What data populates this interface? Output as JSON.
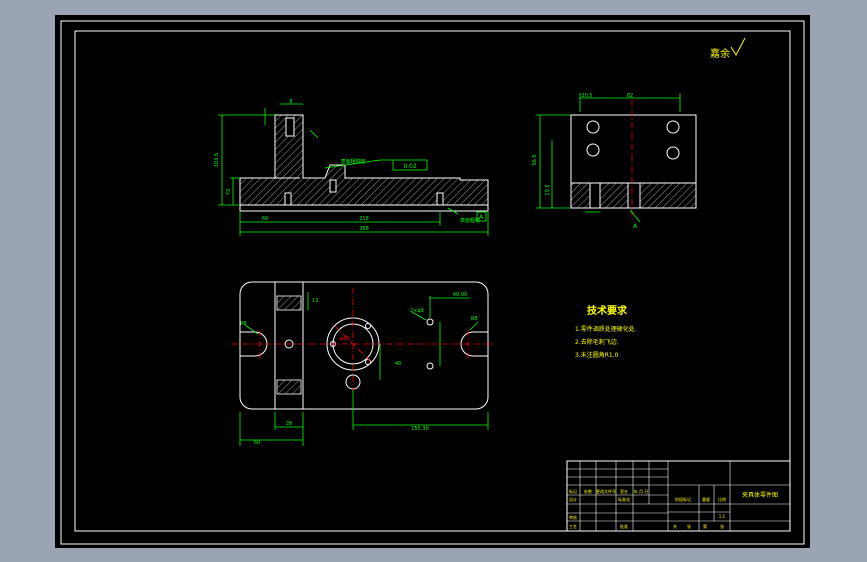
{
  "surface_note": "嘉余",
  "colors": {
    "background": "#000000",
    "outline": "#ffffff",
    "dimension": "#00ff00",
    "centerline": "#ff0000",
    "hatch": "#808080",
    "text_yellow": "#ffff00",
    "viewport_bg": "#9aa4b2"
  },
  "tech_requirements": {
    "title": "技术要求",
    "items": [
      "1.零件调质处理硬化处.",
      "2.去除毛刺飞边.",
      "3.未注圆角R1.0"
    ]
  },
  "title_block": {
    "drawing_name": "夹具体零件图",
    "scale": "1:1",
    "rows": {
      "mark_row": [
        "标记",
        "处数",
        "更改文件号",
        "签名",
        "年.月.日"
      ],
      "design": "设计",
      "review": "审核",
      "process": "工艺",
      "approve": "批准",
      "standardization": "标准化",
      "stage_mark": "阶段标记",
      "weight": "重量",
      "ratio": "比例",
      "sheet_total": "共",
      "sheet_no": "张",
      "sheet_of": "第",
      "sheet_no2": "张"
    }
  },
  "dimensions": {
    "front_view": {
      "total_length": "268",
      "inner_length": "218",
      "left_offset": "60",
      "height": "45",
      "heights": [
        "103.5",
        "73"
      ],
      "slot_width": "8",
      "tolerance_box": "0.02",
      "datum": "A",
      "note1": "表面粗糙度",
      "note2": "表面粗糙"
    },
    "side_view": {
      "width_total": "82",
      "width_left": "20.5",
      "height_top": "56.5",
      "height_base": "19.5",
      "section_mark": "A"
    },
    "top_view": {
      "width_left": "60",
      "width_mid": "28",
      "length_right": "155.30",
      "hole_dim": "φ60",
      "offset_right": "40.90",
      "hole_pitch": "40",
      "hole_label": "2×φ9",
      "slot_label": "R8",
      "slot_label2": "R8",
      "spacing": "13"
    }
  }
}
